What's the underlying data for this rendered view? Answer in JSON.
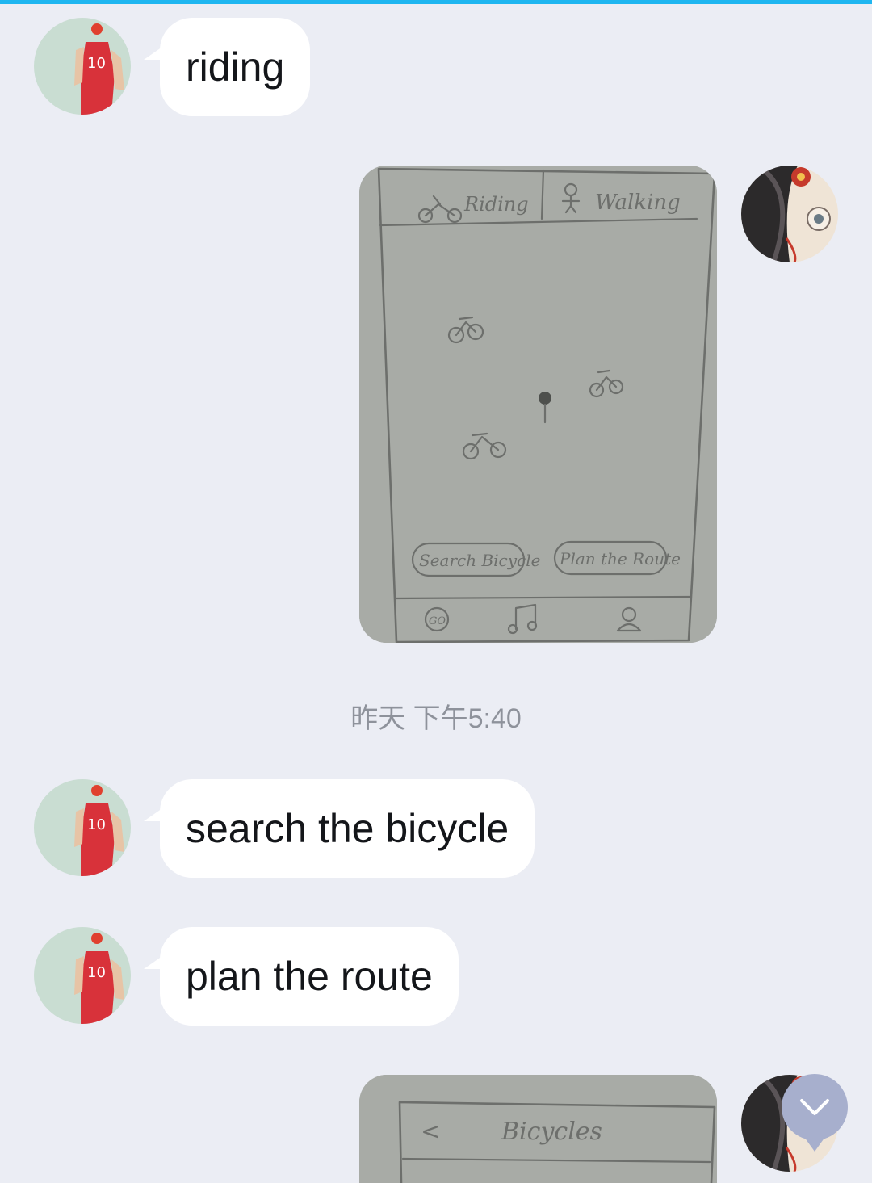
{
  "messages": [
    {
      "type": "text",
      "side": "left",
      "text": "riding"
    },
    {
      "type": "image",
      "side": "right",
      "sketch": {
        "tab_riding": "Riding",
        "tab_walking": "Walking",
        "btn_search": "Search Bicycle",
        "btn_plan": "Plan the Route",
        "nav_go": "GO",
        "nav_music_icon": "music-note-icon",
        "nav_profile_icon": "person-icon"
      }
    },
    {
      "type": "text",
      "side": "left",
      "text": "search the bicycle"
    },
    {
      "type": "text",
      "side": "left",
      "text": "plan the route"
    },
    {
      "type": "image",
      "side": "right",
      "sketch": {
        "back": "<",
        "title": "Bicycles"
      }
    }
  ],
  "timestamp": "昨天 下午5:40",
  "scroll_button": {
    "icon": "chevron-down-icon"
  },
  "colors": {
    "background": "#ebedf4",
    "bubble": "#ffffff",
    "accent_line": "#1fb6f0",
    "scroll_button": "#a7afcd"
  }
}
